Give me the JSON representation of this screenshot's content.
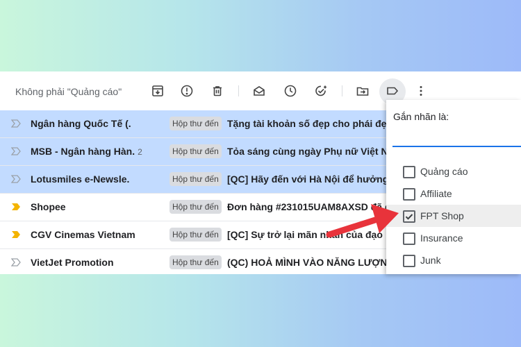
{
  "toolbar": {
    "not_ads_label": "Không phải \"Quảng cáo\"",
    "icons": [
      "archive-icon",
      "report-spam-icon",
      "delete-icon",
      "mark-read-icon",
      "snooze-icon",
      "add-task-icon",
      "move-to-icon",
      "label-icon",
      "more-icon"
    ]
  },
  "emails": [
    {
      "sender": "Ngân hàng Quốc Tế (.",
      "count": "",
      "tag": "Hộp thư đến",
      "subject": "Tặng tài khoản số đẹp cho phái đẹ",
      "selected": true,
      "important": false
    },
    {
      "sender": "MSB - Ngân hàng Hàn.",
      "count": "2",
      "tag": "Hộp thư đến",
      "subject": "Tỏa sáng cùng ngày Phụ nữ Việt N",
      "selected": true,
      "important": false
    },
    {
      "sender": "Lotusmiles e-Newsle.",
      "count": "",
      "tag": "Hộp thư đến",
      "subject": "[QC] Hãy đến với Hà Nội để hưởng",
      "selected": true,
      "important": false
    },
    {
      "sender": "Shopee",
      "count": "",
      "tag": "Hộp thư đến",
      "subject": "Đơn hàng #231015UAM8AXSD đã g",
      "selected": false,
      "important": true
    },
    {
      "sender": "CGV Cinemas Vietnam",
      "count": "",
      "tag": "Hộp thư đến",
      "subject": "[QC] Sự trở lại mãn nhãn của đạo",
      "selected": false,
      "important": true
    },
    {
      "sender": "VietJet Promotion",
      "count": "",
      "tag": "Hộp thư đến",
      "subject": "(QC) HOẢ MÌNH VÀO NĂNG LƯỢN",
      "selected": false,
      "important": false
    }
  ],
  "label_popup": {
    "title": "Gắn nhãn là:",
    "input_value": "",
    "options": [
      {
        "label": "Quảng cáo",
        "checked": false
      },
      {
        "label": "Affiliate",
        "checked": false
      },
      {
        "label": "FPT Shop",
        "checked": true
      },
      {
        "label": "Insurance",
        "checked": false
      },
      {
        "label": "Junk",
        "checked": false
      }
    ]
  },
  "colors": {
    "selected_row": "#c2dbff",
    "important_marker": "#f4b400",
    "accent_blue": "#1a73e8",
    "annotation_arrow": "#e8333b"
  }
}
